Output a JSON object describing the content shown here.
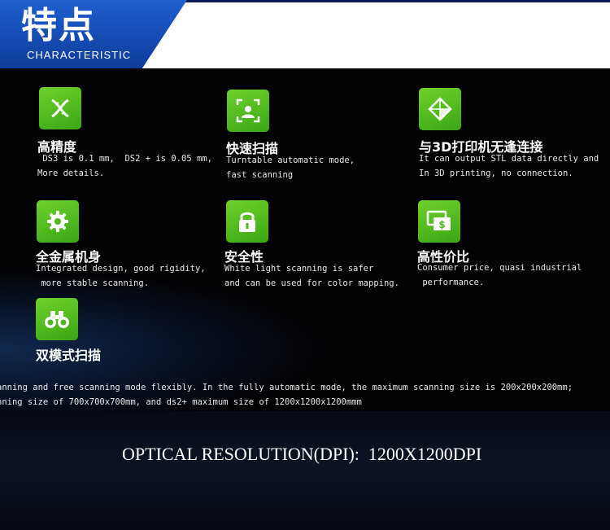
{
  "header": {
    "title_cn": "特点",
    "title_en": "CHARACTERISTIC"
  },
  "features": [
    {
      "title": "高精度",
      "line1": " DS3 is 0.1 mm,  DS2 + is 0.05 mm,",
      "line2": "More details.",
      "icon": "dna-icon"
    },
    {
      "title": "快速扫描",
      "line1": "Turntable automatic mode,",
      "line2": "fast scanning",
      "icon": "scan-icon"
    },
    {
      "title": "与3D打印机无逢连接",
      "line1": "It can output STL data directly and",
      "line2": "In 3D printing, no connection.",
      "icon": "cube-icon"
    },
    {
      "title": "全金属机身",
      "line1": "Integrated design, good rigidity,",
      "line2": " more stable scanning.",
      "icon": "gear-icon"
    },
    {
      "title": "安全性",
      "line1": "White light scanning is safer",
      "line2": "and can be used for color mapping.",
      "icon": "lock-icon"
    },
    {
      "title": "高性价比",
      "line1": "Consumer price, quasi industrial",
      "line2": " performance.",
      "icon": "price-icon"
    },
    {
      "title": "双模式扫描",
      "icon": "binoculars-icon"
    }
  ],
  "dual_mode_text": {
    "line1": "anning and free scanning mode flexibly. In the fully automatic mode, the maximum scanning size is 200x200x200mm;",
    "line2": "nning size of 700x700x700mm, and ds2+ maximum size of 1200x1200x1200mmm"
  },
  "optical_resolution": "OPTICAL RESOLUTION(DPI):  1200X1200DPI"
}
